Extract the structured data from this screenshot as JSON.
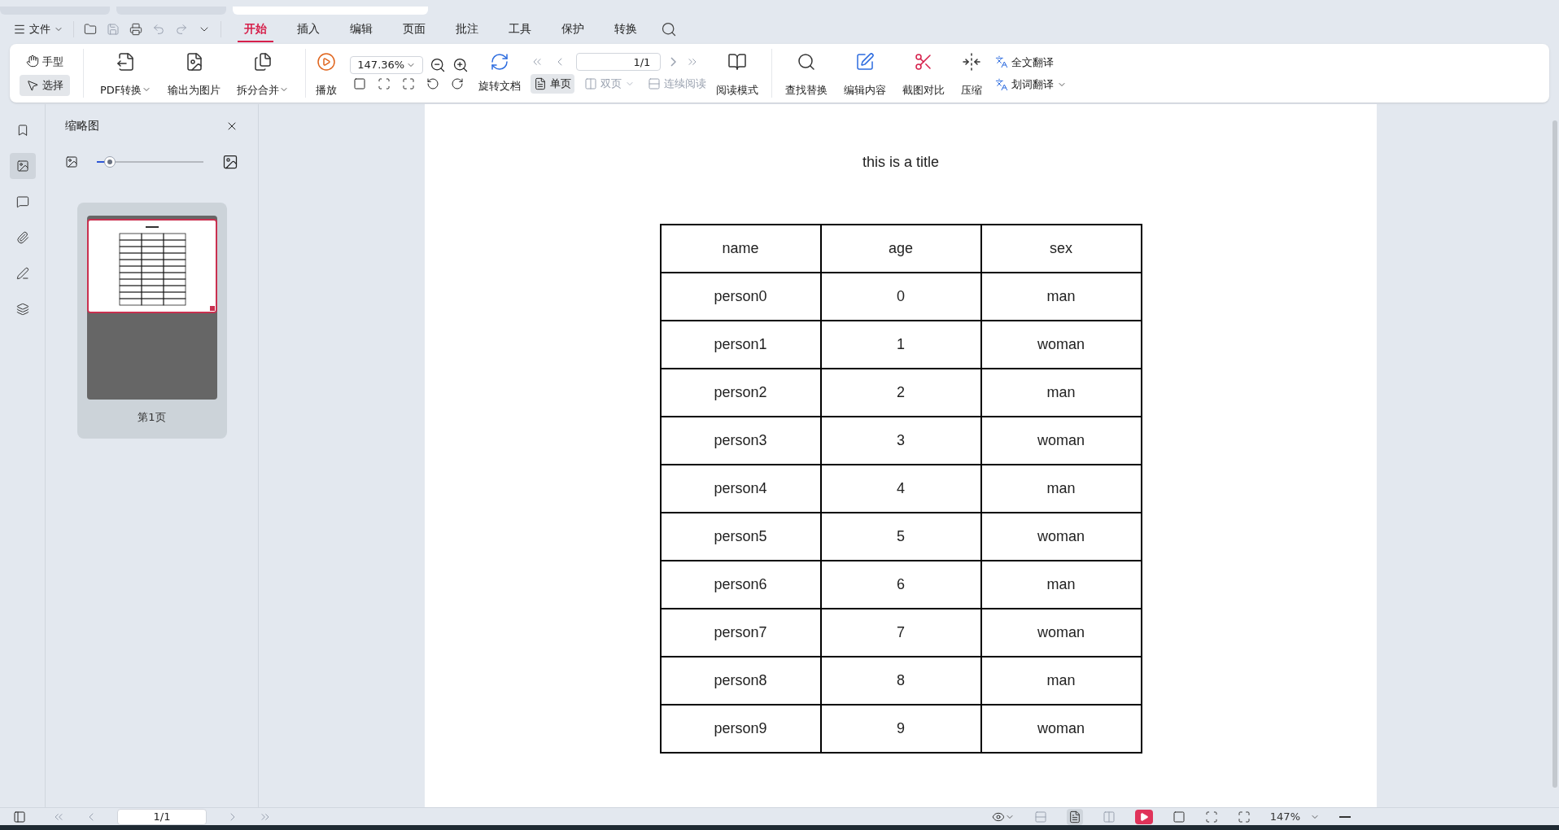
{
  "window_tabs": [
    {
      "selected": false
    },
    {
      "selected": false
    },
    {
      "selected": true
    }
  ],
  "menu": {
    "file_label": "文件",
    "tabs": [
      {
        "label": "开始",
        "selected": true
      },
      {
        "label": "插入",
        "selected": false
      },
      {
        "label": "编辑",
        "selected": false
      },
      {
        "label": "页面",
        "selected": false
      },
      {
        "label": "批注",
        "selected": false
      },
      {
        "label": "工具",
        "selected": false
      },
      {
        "label": "保护",
        "selected": false
      },
      {
        "label": "转换",
        "selected": false
      }
    ]
  },
  "toolbar": {
    "modes": [
      {
        "label": "手型",
        "selected": false
      },
      {
        "label": "选择",
        "selected": true
      }
    ],
    "convert": [
      {
        "label": "PDF转换",
        "dropdown": true
      },
      {
        "label": "输出为图片",
        "dropdown": false
      },
      {
        "label": "拆分合并",
        "dropdown": true
      }
    ],
    "play": "播放",
    "zoom": "147.36%",
    "rotate": "旋转文档",
    "page_field": "1/1",
    "views": [
      {
        "label": "单页",
        "selected": true,
        "disabled": false,
        "dropdown": false
      },
      {
        "label": "双页",
        "selected": false,
        "disabled": true,
        "dropdown": true
      },
      {
        "label": "连续阅读",
        "selected": false,
        "disabled": true,
        "dropdown": false
      }
    ],
    "reading_mode": "阅读模式",
    "tools": [
      "查找替换",
      "编辑内容",
      "截图对比",
      "压缩"
    ],
    "translate": [
      {
        "label": "全文翻译",
        "dropdown": false
      },
      {
        "label": "划词翻译",
        "dropdown": true
      }
    ]
  },
  "sidebar": {
    "rail": [
      {
        "kind": "bookmark",
        "selected": false
      },
      {
        "kind": "thumbnail",
        "selected": true
      },
      {
        "kind": "comment",
        "selected": false
      },
      {
        "kind": "attachment",
        "selected": false
      },
      {
        "kind": "sign",
        "selected": false
      },
      {
        "kind": "layers",
        "selected": false
      }
    ],
    "title": "缩略图",
    "slider": {
      "level": 0.12
    },
    "thumbnails": [
      {
        "label": "第1页",
        "selected": true
      }
    ]
  },
  "document": {
    "title": "this is a title",
    "columns": [
      "name",
      "age",
      "sex"
    ],
    "rows": [
      [
        "person0",
        "0",
        "man"
      ],
      [
        "person1",
        "1",
        "woman"
      ],
      [
        "person2",
        "2",
        "man"
      ],
      [
        "person3",
        "3",
        "woman"
      ],
      [
        "person4",
        "4",
        "man"
      ],
      [
        "person5",
        "5",
        "woman"
      ],
      [
        "person6",
        "6",
        "man"
      ],
      [
        "person7",
        "7",
        "woman"
      ],
      [
        "person8",
        "8",
        "man"
      ],
      [
        "person9",
        "9",
        "woman"
      ]
    ]
  },
  "status_bar": {
    "page_field": "1/1",
    "zoom": "147%",
    "single_page_selected": true
  }
}
